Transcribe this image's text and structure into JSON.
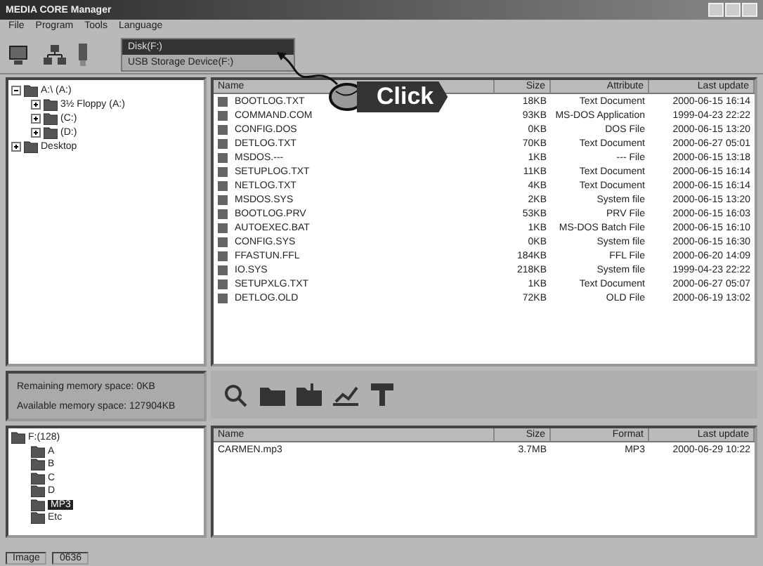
{
  "window": {
    "title": "MEDIA CORE Manager"
  },
  "menu": [
    "File",
    "Program",
    "Tools",
    "Language"
  ],
  "drive_dropdown": {
    "options": [
      {
        "label": "Disk(F:)",
        "selected": true
      },
      {
        "label": "USB Storage Device(F:)",
        "selected": false
      }
    ]
  },
  "callout": {
    "label": "Click"
  },
  "folder_tree": [
    {
      "label": "A:\\ (A:)",
      "expanded": true,
      "children": [
        {
          "label": "3½ Floppy (A:)",
          "expanded": false
        },
        {
          "label": "(C:)",
          "expanded": false
        },
        {
          "label": "(D:)",
          "expanded": false
        }
      ]
    },
    {
      "label": "Desktop",
      "expanded": false
    }
  ],
  "file_list": {
    "columns": [
      "Name",
      "Size",
      "Attribute",
      "Last update"
    ],
    "rows": [
      {
        "name": "BOOTLOG.TXT",
        "size": "18KB",
        "type": "Text Document",
        "date": "2000-06-15 16:14"
      },
      {
        "name": "COMMAND.COM",
        "size": "93KB",
        "type": "MS-DOS Application",
        "date": "1999-04-23 22:22"
      },
      {
        "name": "CONFIG.DOS",
        "size": "0KB",
        "type": "DOS File",
        "date": "2000-06-15 13:20"
      },
      {
        "name": "DETLOG.TXT",
        "size": "70KB",
        "type": "Text Document",
        "date": "2000-06-27 05:01"
      },
      {
        "name": "MSDOS.---",
        "size": "1KB",
        "type": "--- File",
        "date": "2000-06-15 13:18"
      },
      {
        "name": "SETUPLOG.TXT",
        "size": "11KB",
        "type": "Text Document",
        "date": "2000-06-15 16:14"
      },
      {
        "name": "NETLOG.TXT",
        "size": "4KB",
        "type": "Text Document",
        "date": "2000-06-15 16:14"
      },
      {
        "name": "MSDOS.SYS",
        "size": "2KB",
        "type": "System file",
        "date": "2000-06-15 13:20"
      },
      {
        "name": "BOOTLOG.PRV",
        "size": "53KB",
        "type": "PRV File",
        "date": "2000-06-15 16:03"
      },
      {
        "name": "AUTOEXEC.BAT",
        "size": "1KB",
        "type": "MS-DOS Batch File",
        "date": "2000-06-15 16:10"
      },
      {
        "name": "CONFIG.SYS",
        "size": "0KB",
        "type": "System file",
        "date": "2000-06-15 16:30"
      },
      {
        "name": "FFASTUN.FFL",
        "size": "184KB",
        "type": "FFL File",
        "date": "2000-06-20 14:09"
      },
      {
        "name": "IO.SYS",
        "size": "218KB",
        "type": "System file",
        "date": "1999-04-23 22:22"
      },
      {
        "name": "SETUPXLG.TXT",
        "size": "1KB",
        "type": "Text Document",
        "date": "2000-06-27 05:07"
      },
      {
        "name": "DETLOG.OLD",
        "size": "72KB",
        "type": "OLD File",
        "date": "2000-06-19 13:02"
      }
    ]
  },
  "memory": {
    "remaining": "Remaining memory space: 0KB",
    "available": "Available memory space: 127904KB"
  },
  "device_tree": [
    {
      "label": "F:(128)",
      "selected": false,
      "children": [
        {
          "label": "A",
          "selected": false
        },
        {
          "label": "B",
          "selected": false
        },
        {
          "label": "C",
          "selected": false
        },
        {
          "label": "D",
          "selected": false
        },
        {
          "label": "MP3",
          "selected": true
        },
        {
          "label": "Etc",
          "selected": false
        }
      ]
    }
  ],
  "device_list": {
    "columns": [
      "Name",
      "Size",
      "Format",
      "Last update"
    ],
    "rows": [
      {
        "name": "CARMEN.mp3",
        "size": "3.7MB",
        "format": "MP3",
        "date": "2000-06-29 10:22"
      }
    ]
  },
  "status_bar": [
    "Image",
    "0636"
  ]
}
